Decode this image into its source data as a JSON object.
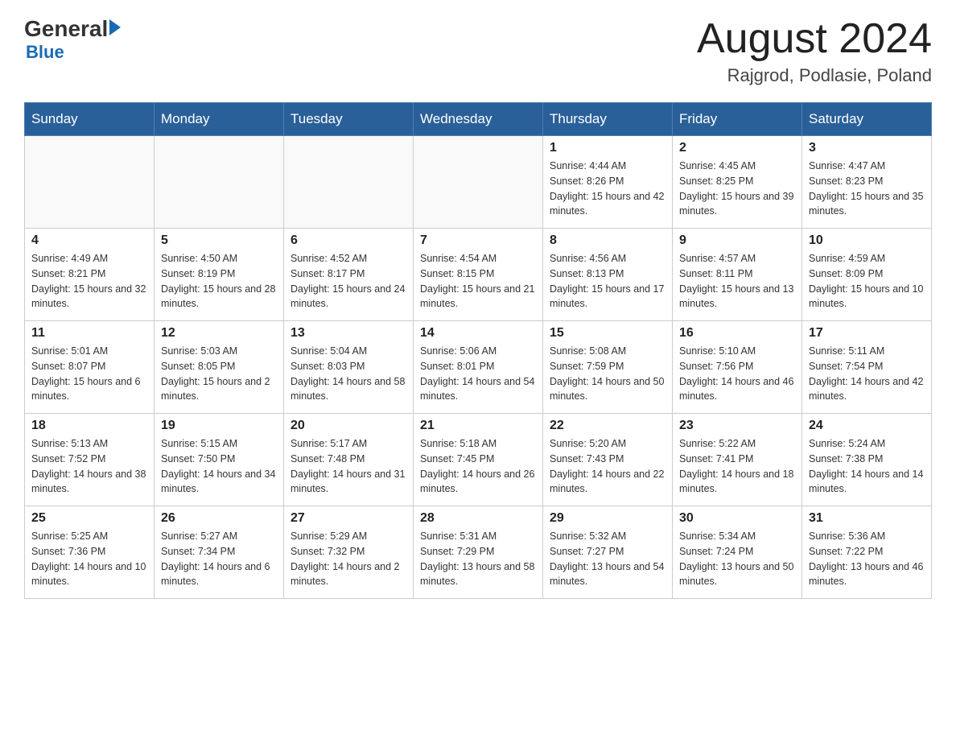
{
  "header": {
    "logo_text1": "General",
    "logo_text2": "Blue",
    "month": "August 2024",
    "location": "Rajgrod, Podlasie, Poland"
  },
  "days_of_week": [
    "Sunday",
    "Monday",
    "Tuesday",
    "Wednesday",
    "Thursday",
    "Friday",
    "Saturday"
  ],
  "weeks": [
    [
      {
        "day": "",
        "info": ""
      },
      {
        "day": "",
        "info": ""
      },
      {
        "day": "",
        "info": ""
      },
      {
        "day": "",
        "info": ""
      },
      {
        "day": "1",
        "info": "Sunrise: 4:44 AM\nSunset: 8:26 PM\nDaylight: 15 hours and 42 minutes."
      },
      {
        "day": "2",
        "info": "Sunrise: 4:45 AM\nSunset: 8:25 PM\nDaylight: 15 hours and 39 minutes."
      },
      {
        "day": "3",
        "info": "Sunrise: 4:47 AM\nSunset: 8:23 PM\nDaylight: 15 hours and 35 minutes."
      }
    ],
    [
      {
        "day": "4",
        "info": "Sunrise: 4:49 AM\nSunset: 8:21 PM\nDaylight: 15 hours and 32 minutes."
      },
      {
        "day": "5",
        "info": "Sunrise: 4:50 AM\nSunset: 8:19 PM\nDaylight: 15 hours and 28 minutes."
      },
      {
        "day": "6",
        "info": "Sunrise: 4:52 AM\nSunset: 8:17 PM\nDaylight: 15 hours and 24 minutes."
      },
      {
        "day": "7",
        "info": "Sunrise: 4:54 AM\nSunset: 8:15 PM\nDaylight: 15 hours and 21 minutes."
      },
      {
        "day": "8",
        "info": "Sunrise: 4:56 AM\nSunset: 8:13 PM\nDaylight: 15 hours and 17 minutes."
      },
      {
        "day": "9",
        "info": "Sunrise: 4:57 AM\nSunset: 8:11 PM\nDaylight: 15 hours and 13 minutes."
      },
      {
        "day": "10",
        "info": "Sunrise: 4:59 AM\nSunset: 8:09 PM\nDaylight: 15 hours and 10 minutes."
      }
    ],
    [
      {
        "day": "11",
        "info": "Sunrise: 5:01 AM\nSunset: 8:07 PM\nDaylight: 15 hours and 6 minutes."
      },
      {
        "day": "12",
        "info": "Sunrise: 5:03 AM\nSunset: 8:05 PM\nDaylight: 15 hours and 2 minutes."
      },
      {
        "day": "13",
        "info": "Sunrise: 5:04 AM\nSunset: 8:03 PM\nDaylight: 14 hours and 58 minutes."
      },
      {
        "day": "14",
        "info": "Sunrise: 5:06 AM\nSunset: 8:01 PM\nDaylight: 14 hours and 54 minutes."
      },
      {
        "day": "15",
        "info": "Sunrise: 5:08 AM\nSunset: 7:59 PM\nDaylight: 14 hours and 50 minutes."
      },
      {
        "day": "16",
        "info": "Sunrise: 5:10 AM\nSunset: 7:56 PM\nDaylight: 14 hours and 46 minutes."
      },
      {
        "day": "17",
        "info": "Sunrise: 5:11 AM\nSunset: 7:54 PM\nDaylight: 14 hours and 42 minutes."
      }
    ],
    [
      {
        "day": "18",
        "info": "Sunrise: 5:13 AM\nSunset: 7:52 PM\nDaylight: 14 hours and 38 minutes."
      },
      {
        "day": "19",
        "info": "Sunrise: 5:15 AM\nSunset: 7:50 PM\nDaylight: 14 hours and 34 minutes."
      },
      {
        "day": "20",
        "info": "Sunrise: 5:17 AM\nSunset: 7:48 PM\nDaylight: 14 hours and 31 minutes."
      },
      {
        "day": "21",
        "info": "Sunrise: 5:18 AM\nSunset: 7:45 PM\nDaylight: 14 hours and 26 minutes."
      },
      {
        "day": "22",
        "info": "Sunrise: 5:20 AM\nSunset: 7:43 PM\nDaylight: 14 hours and 22 minutes."
      },
      {
        "day": "23",
        "info": "Sunrise: 5:22 AM\nSunset: 7:41 PM\nDaylight: 14 hours and 18 minutes."
      },
      {
        "day": "24",
        "info": "Sunrise: 5:24 AM\nSunset: 7:38 PM\nDaylight: 14 hours and 14 minutes."
      }
    ],
    [
      {
        "day": "25",
        "info": "Sunrise: 5:25 AM\nSunset: 7:36 PM\nDaylight: 14 hours and 10 minutes."
      },
      {
        "day": "26",
        "info": "Sunrise: 5:27 AM\nSunset: 7:34 PM\nDaylight: 14 hours and 6 minutes."
      },
      {
        "day": "27",
        "info": "Sunrise: 5:29 AM\nSunset: 7:32 PM\nDaylight: 14 hours and 2 minutes."
      },
      {
        "day": "28",
        "info": "Sunrise: 5:31 AM\nSunset: 7:29 PM\nDaylight: 13 hours and 58 minutes."
      },
      {
        "day": "29",
        "info": "Sunrise: 5:32 AM\nSunset: 7:27 PM\nDaylight: 13 hours and 54 minutes."
      },
      {
        "day": "30",
        "info": "Sunrise: 5:34 AM\nSunset: 7:24 PM\nDaylight: 13 hours and 50 minutes."
      },
      {
        "day": "31",
        "info": "Sunrise: 5:36 AM\nSunset: 7:22 PM\nDaylight: 13 hours and 46 minutes."
      }
    ]
  ]
}
